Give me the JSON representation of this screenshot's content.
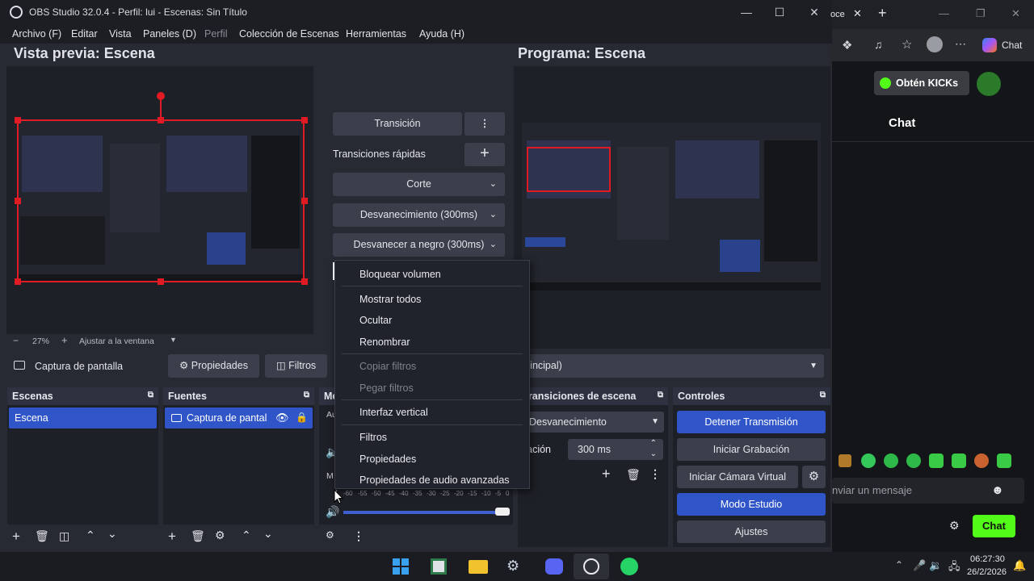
{
  "window": {
    "title": "OBS Studio 32.0.4 - Perfil: lui - Escenas: Sin Título"
  },
  "menu": [
    "Archivo (F)",
    "Editar",
    "Vista",
    "Paneles (D)",
    "Perfil",
    "Colección de Escenas",
    "Herramientas",
    "Ayuda (H)"
  ],
  "preview": {
    "title": "Vista previa: Escena",
    "zoom": "27%",
    "fit": "Ajustar a la ventana"
  },
  "program": {
    "title": "Programa: Escena"
  },
  "transitions": {
    "transition_btn": "Transición",
    "quick_label": "Transiciones rápidas",
    "items": [
      "Corte",
      "Desvanecimiento (300ms)",
      "Desvanecer a negro (300ms)"
    ]
  },
  "source_toolbar": {
    "source_name": "Captura de pantalla",
    "props": "Propiedades",
    "filters": "Filtros",
    "display": "rincipal)"
  },
  "context_menu": {
    "items": [
      "Bloquear volumen",
      "Mostrar todos",
      "Ocultar",
      "Renombrar",
      "Copiar filtros",
      "Pegar filtros",
      "Interfaz vertical",
      "Filtros",
      "Propiedades",
      "Propiedades de audio avanzadas"
    ]
  },
  "docks": {
    "scenes": {
      "title": "Escenas",
      "items": [
        "Escena"
      ]
    },
    "sources": {
      "title": "Fuentes",
      "items": [
        "Captura de pantal"
      ]
    },
    "mixer": {
      "title": "Me",
      "label_a": "Au",
      "label_m": "M",
      "meter_ticks": [
        "-60",
        "-55",
        "-50",
        "-45",
        "-40",
        "-35",
        "-30",
        "-25",
        "-20",
        "-15",
        "-10",
        "-5",
        "0"
      ]
    },
    "scene_transitions": {
      "title": "Transiciones de escena",
      "type": "Desvanecimiento",
      "duration_label": "uración",
      "duration_value": "300 ms"
    },
    "controls": {
      "title": "Controles",
      "buttons": [
        "Detener Transmisión",
        "Iniciar Grabación",
        "Iniciar Cámara Virtual",
        "Modo Estudio",
        "Ajustes"
      ]
    }
  },
  "browser": {
    "tab_title": "oce",
    "chat_header_btn": "Chat",
    "kick_btn": "Obtén KICKs",
    "chat_title": "Chat",
    "message_placeholder": "nviar un mensaje",
    "send_btn": "Chat"
  },
  "taskbar": {
    "time": "06:27:30",
    "date": "26/2/2026"
  },
  "colors": {
    "accent_blue": "#2f55c9",
    "kick_green": "#53fc18",
    "selection_red": "#e01b24"
  }
}
